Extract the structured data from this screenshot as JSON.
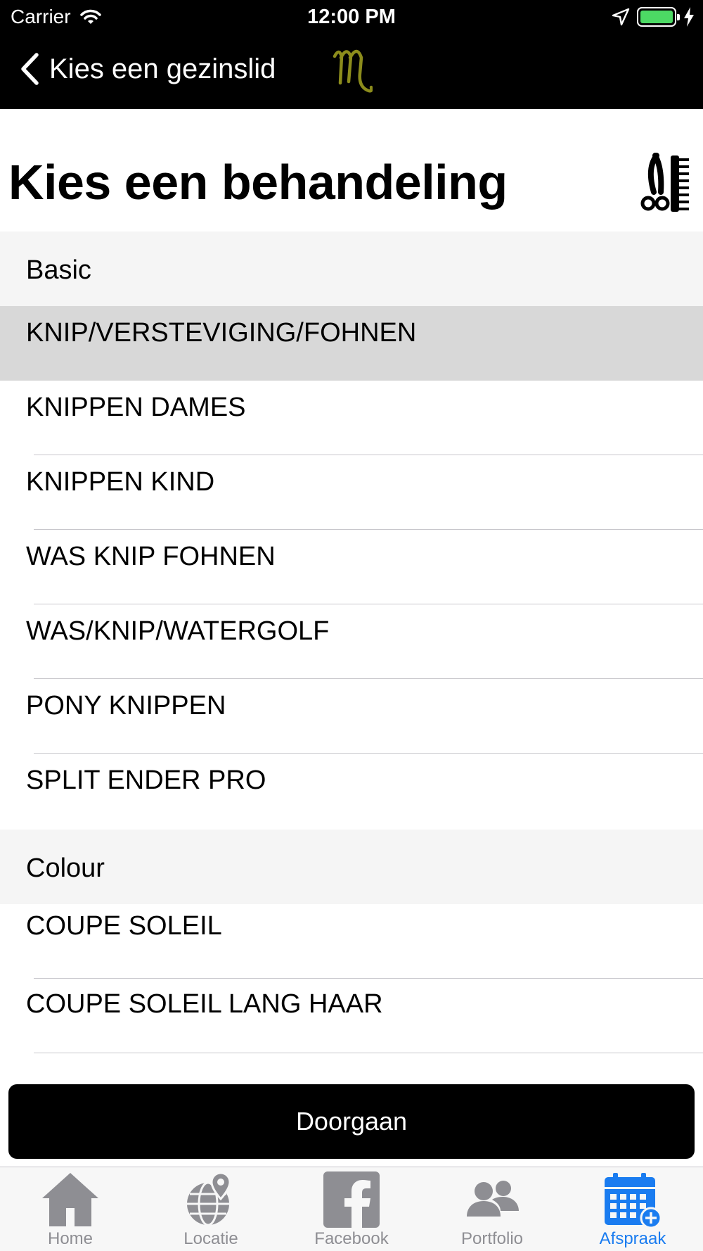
{
  "status_bar": {
    "carrier": "Carrier",
    "time": "12:00 PM"
  },
  "nav": {
    "back_label": "Kies een gezinslid",
    "logo_color": "#8c8c1c"
  },
  "page": {
    "title": "Kies een behandeling"
  },
  "sections": [
    {
      "header": "Basic",
      "items": [
        "KNIP/VERSTEVIGING/FOHNEN",
        "KNIPPEN DAMES",
        "KNIPPEN KIND",
        "WAS KNIP FOHNEN",
        "WAS/KNIP/WATERGOLF",
        "PONY KNIPPEN",
        "SPLIT ENDER PRO"
      ],
      "selected_index": 0
    },
    {
      "header": "Colour",
      "items": [
        "COUPE SOLEIL",
        "COUPE SOLEIL LANG HAAR"
      ]
    }
  ],
  "continue_label": "Doorgaan",
  "tabs": [
    {
      "label": "Home",
      "icon": "home-icon"
    },
    {
      "label": "Locatie",
      "icon": "globe-location-icon"
    },
    {
      "label": "Facebook",
      "icon": "facebook-icon"
    },
    {
      "label": "Portfolio",
      "icon": "people-icon"
    },
    {
      "label": "Afspraak",
      "icon": "calendar-add-icon",
      "active": true
    }
  ],
  "colors": {
    "accent": "#1a7cf0",
    "inactive_tab": "#8e8e93",
    "selected_row": "#d8d8d8",
    "section_bg": "#f5f5f5"
  }
}
